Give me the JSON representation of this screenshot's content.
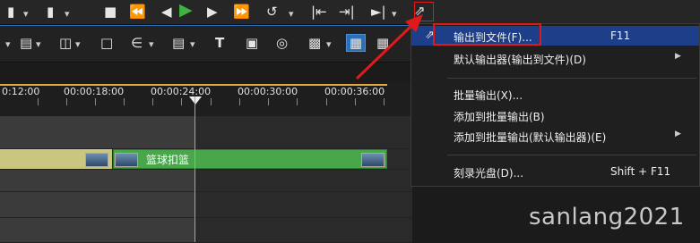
{
  "timeline": {
    "timecodes": [
      "0:12:00",
      "00:00:18:00",
      "00:00:24:00",
      "00:00:30:00",
      "00:00:36:00"
    ],
    "clip_label": "篮球扣篮"
  },
  "menu": {
    "items": [
      {
        "label": "输出到文件(F)...",
        "shortcut": "F11",
        "submenu": false,
        "highlighted": true
      },
      {
        "label": "默认输出器(输出到文件)(D)",
        "shortcut": "",
        "submenu": true,
        "highlighted": false
      },
      {
        "label": "批量输出(X)...",
        "shortcut": "",
        "submenu": false,
        "highlighted": false
      },
      {
        "label": "添加到批量输出(B)",
        "shortcut": "",
        "submenu": false,
        "highlighted": false
      },
      {
        "label": "添加到批量输出(默认输出器)(E)",
        "shortcut": "",
        "submenu": true,
        "highlighted": false
      },
      {
        "label": "刻录光盘(D)...",
        "shortcut": "Shift + F11",
        "submenu": false,
        "highlighted": false
      }
    ],
    "submenu_arrow": "▶"
  },
  "watermark": "sanlang2021",
  "colors": {
    "accent_highlight": "#1d3f8a",
    "annotation_red": "#e01a1a",
    "playhead": "#4ec7c7",
    "clip_green": "#49a64a"
  }
}
